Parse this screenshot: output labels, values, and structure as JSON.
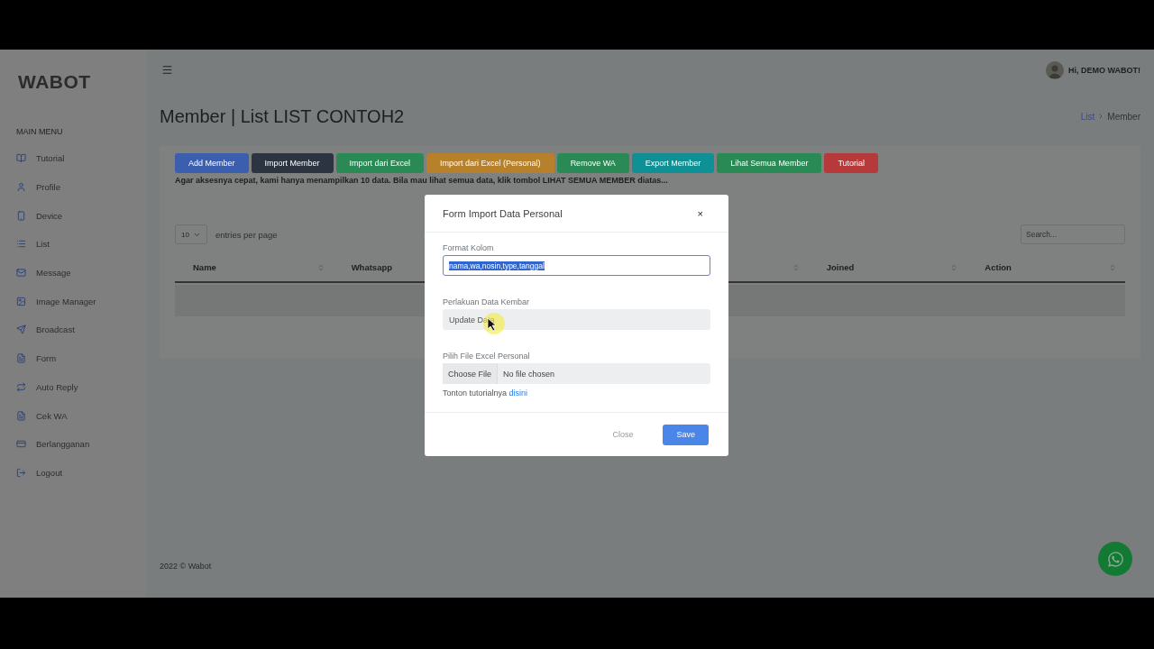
{
  "brand": "WABOT",
  "sidebar": {
    "heading": "MAIN MENU",
    "items": [
      {
        "label": "Tutorial"
      },
      {
        "label": "Profile"
      },
      {
        "label": "Device"
      },
      {
        "label": "List"
      },
      {
        "label": "Message"
      },
      {
        "label": "Image Manager"
      },
      {
        "label": "Broadcast"
      },
      {
        "label": "Form"
      },
      {
        "label": "Auto Reply"
      },
      {
        "label": "Cek WA"
      },
      {
        "label": "Berlangganan"
      },
      {
        "label": "Logout"
      }
    ]
  },
  "topbar": {
    "greeting": "Hi, DEMO WABOT!"
  },
  "page_title": "Member | List LIST CONTOH2",
  "breadcrumb": [
    {
      "label": "List",
      "kind": "link"
    },
    {
      "label": "Member",
      "kind": "current"
    }
  ],
  "actions": [
    {
      "label": "Add Member",
      "color": "#3b5fae"
    },
    {
      "label": "Import Member",
      "color": "#2b3440"
    },
    {
      "label": "Import dari Excel",
      "color": "#2a8a55"
    },
    {
      "label": "Import dari Excel (Personal)",
      "color": "#b7812c"
    },
    {
      "label": "Remove WA",
      "color": "#2a8a55"
    },
    {
      "label": "Export Member",
      "color": "#0e9095"
    },
    {
      "label": "Lihat Semua Member",
      "color": "#2a8a55"
    },
    {
      "label": "Tutorial",
      "color": "#b73a3a"
    }
  ],
  "notice": "Agar aksesnya cepat, kami hanya menampilkan 10 data. Bila mau lihat semua data, klik tombol LIHAT SEMUA MEMBER diatas...",
  "table": {
    "page_size": "10",
    "page_size_label": "entries per page",
    "search_placeholder": "Search...",
    "columns": [
      {
        "kind": "header",
        "label": "Name"
      },
      {
        "kind": "label_only",
        "label": "Whatsapp"
      },
      {
        "kind": "covered"
      },
      {
        "kind": "header",
        "label": "Joined"
      },
      {
        "kind": "header",
        "label": "Action"
      }
    ]
  },
  "footer": "2022 © Wabot",
  "modal": {
    "title": "Form Import Data Personal",
    "close_mark": "×",
    "fields": [
      {
        "kind": "text",
        "label": "Format Kolom",
        "value": "nama,wa,nosin,type,tanggal",
        "selected": true
      },
      {
        "kind": "select",
        "label": "Perlakuan Data Kembar",
        "value": "Update Data"
      },
      {
        "kind": "file",
        "label": "Pilih File Excel Personal",
        "button": "Choose File",
        "value": "No file chosen"
      }
    ],
    "help": {
      "text": "Tonton tutorialnya",
      "link": "disini"
    },
    "buttons": [
      {
        "label": "Close",
        "kind": "secondary"
      },
      {
        "label": "Save",
        "kind": "primary"
      }
    ]
  }
}
